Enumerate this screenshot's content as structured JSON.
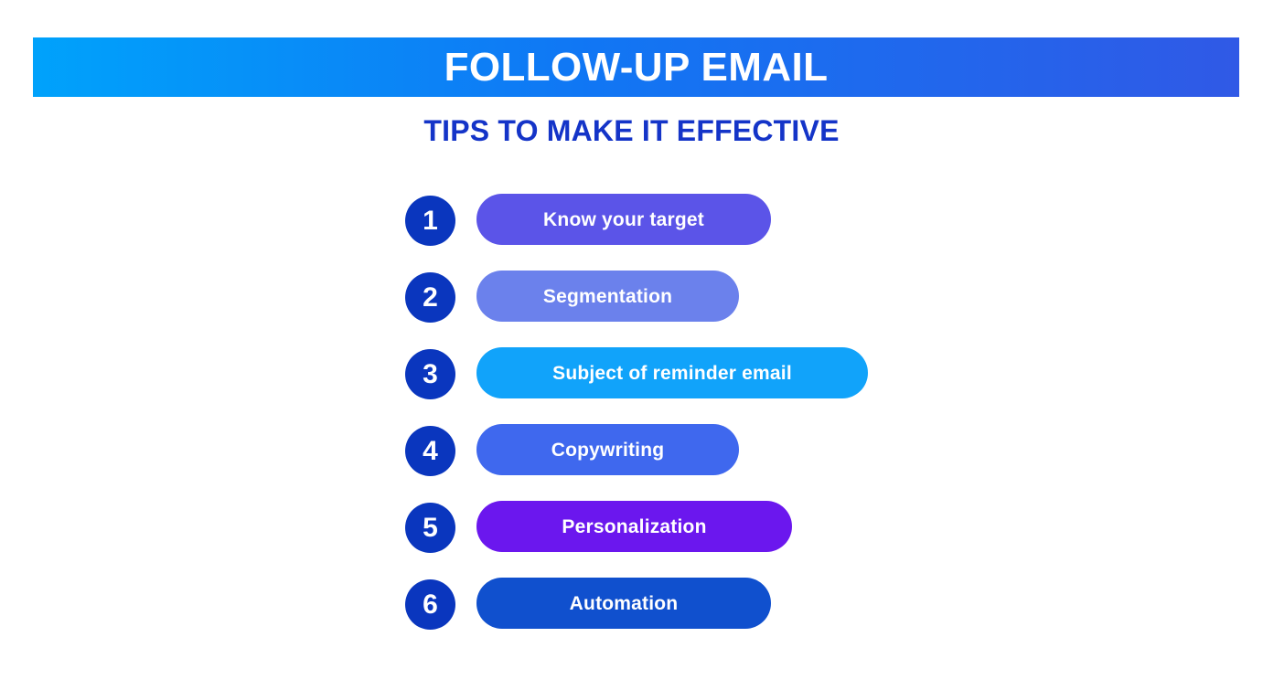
{
  "header": {
    "title": "FOLLOW-UP EMAIL",
    "subtitle": "TIPS TO MAKE IT EFFECTIVE",
    "banner_gradient_start": "#00A2FB",
    "banner_gradient_mid": "#1077F4",
    "banner_gradient_end": "#3059E6",
    "subtitle_color": "#1434C8"
  },
  "badge_color": "#0A36BE",
  "tips": [
    {
      "number": "1",
      "label": "Know your target",
      "pill_color": "#5B54E8",
      "pill_width": 322
    },
    {
      "number": "2",
      "label": "Segmentation",
      "pill_color": "#6B81EC",
      "pill_width": 287
    },
    {
      "number": "3",
      "label": "Subject of reminder email",
      "pill_color": "#11A3FA",
      "pill_width": 428
    },
    {
      "number": "4",
      "label": "Copywriting",
      "pill_color": "#3F68EE",
      "pill_width": 287
    },
    {
      "number": "5",
      "label": "Personalization",
      "pill_color": "#6B17EE",
      "pill_width": 345
    },
    {
      "number": "6",
      "label": "Automation",
      "pill_color": "#1050CE",
      "pill_width": 322
    }
  ]
}
